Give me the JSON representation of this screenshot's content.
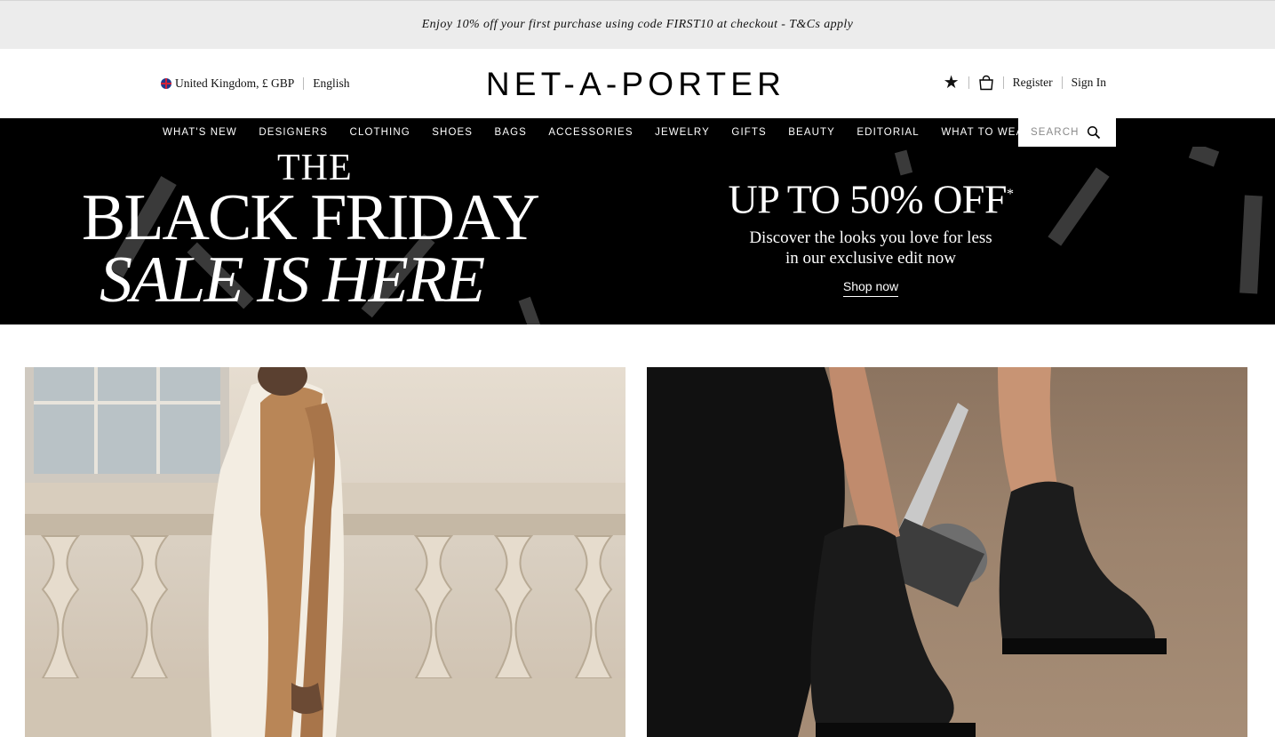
{
  "promo_bar": {
    "text": "Enjoy 10% off your first purchase using code FIRST10 at checkout - T&Cs apply"
  },
  "header": {
    "locale": "United Kingdom, £ GBP",
    "language": "English",
    "logo": "NET-A-PORTER",
    "register": "Register",
    "sign_in": "Sign In",
    "icons": {
      "wishlist": "star-icon",
      "bag": "shopping-bag-icon",
      "flag": "uk-flag-icon"
    }
  },
  "nav": {
    "items": [
      "WHAT'S NEW",
      "DESIGNERS",
      "CLOTHING",
      "SHOES",
      "BAGS",
      "ACCESSORIES",
      "JEWELRY",
      "GIFTS",
      "BEAUTY",
      "EDITORIAL",
      "WHAT TO WEAR"
    ],
    "search_placeholder": "SEARCH"
  },
  "banner": {
    "title_line1": "THE",
    "title_line2": "BLACK FRIDAY",
    "title_line3": "SALE IS HERE",
    "offer": "UP TO 50% OFF",
    "offer_mark": "*",
    "sub_line1": "Discover the looks you love for less",
    "sub_line2": "in our exclusive edit now",
    "cta": "Shop now"
  },
  "tiles": [
    {
      "subject": "woman in cream knit cape with tan scarf by stone balustrade"
    },
    {
      "subject": "black chelsea boots on brown background"
    }
  ]
}
